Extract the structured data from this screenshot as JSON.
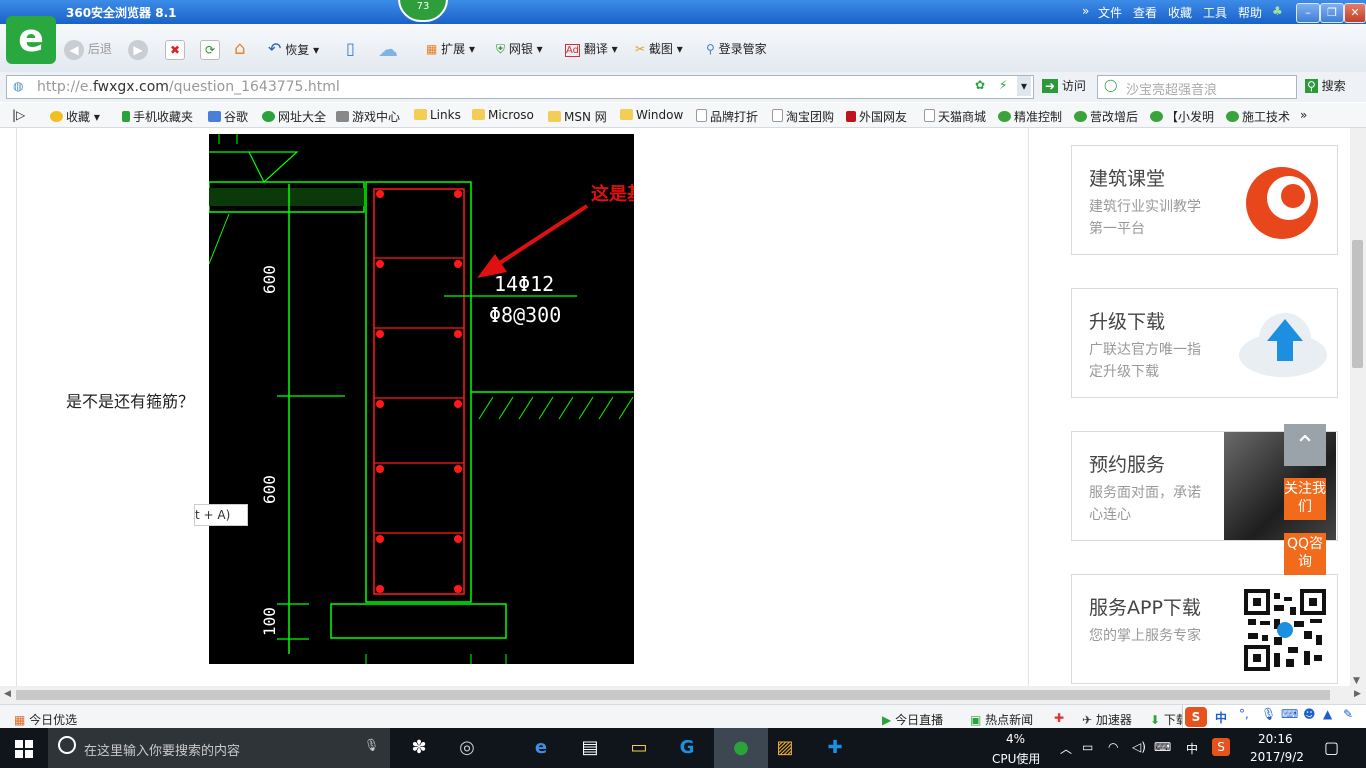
{
  "window": {
    "title": "360安全浏览器 8.1",
    "badge": "73",
    "menu": [
      "文件",
      "查看",
      "收藏",
      "工具",
      "帮助"
    ]
  },
  "toolbar": {
    "back_label": "后退",
    "restore_label": "恢复",
    "extend_label": "扩展",
    "bank_label": "网银",
    "translate_label": "翻译",
    "screenshot_label": "截图",
    "login_label": "登录管家"
  },
  "address": {
    "url_prefix": "http://e.",
    "url_domain": "fwxgx.com",
    "url_path": "/question_1643775.html",
    "visit_label": "访问",
    "search_placeholder": "沙宝亮超强音浪",
    "search_button": "搜索"
  },
  "bookmarks": [
    "收藏",
    "手机收藏夹",
    "谷歌",
    "网址大全",
    "游戏中心",
    "Links",
    "Microso",
    "MSN 网",
    "Window",
    "品牌打折",
    "淘宝团购",
    "外国网友",
    "天猫商城",
    "精准控制",
    "营改增后",
    "【小发明",
    "施工技术"
  ],
  "content": {
    "question": "是不是还有箍筋？",
    "annotation": "这是基础梁，不是条形基础",
    "dim_labels": [
      "600",
      "600",
      "100"
    ],
    "rebar_main": "14Φ12",
    "rebar_stirrup": "Φ8@300",
    "tooltip": "t + A)"
  },
  "sidebar": {
    "cards": [
      {
        "title": "建筑课堂",
        "desc": "建筑行业实训教学第一平台",
        "icon": "flame-logo-icon"
      },
      {
        "title": "升级下载",
        "desc": "广联达官方唯一指定升级下载",
        "icon": "cloud-upload-icon"
      },
      {
        "title": "预约服务",
        "desc": "服务面对面，承诺心连心",
        "icon": "handshake-photo-icon"
      },
      {
        "title": "服务APP下载",
        "desc": "您的掌上服务专家",
        "icon": "qr-code-icon"
      }
    ],
    "follow_label": "关注我们",
    "qq_label": "QQ咨询"
  },
  "statusbar": {
    "left": "今日优选",
    "live": "今日直播",
    "hotnews": "热点新闻",
    "accelerator": "加速器",
    "download": "下载",
    "ime": "中"
  },
  "taskbar": {
    "search_placeholder": "在这里输入你要搜索的内容",
    "cpu_percent": "4%",
    "cpu_label": "CPU使用",
    "ime": "中",
    "time": "20:16",
    "date": "2017/9/2"
  },
  "colors": {
    "accent_green": "#29a83f",
    "cad_line": "#00ff00",
    "cad_rebar": "#ff1a1a",
    "annotation": "#e01010",
    "orange": "#f26a1b"
  }
}
